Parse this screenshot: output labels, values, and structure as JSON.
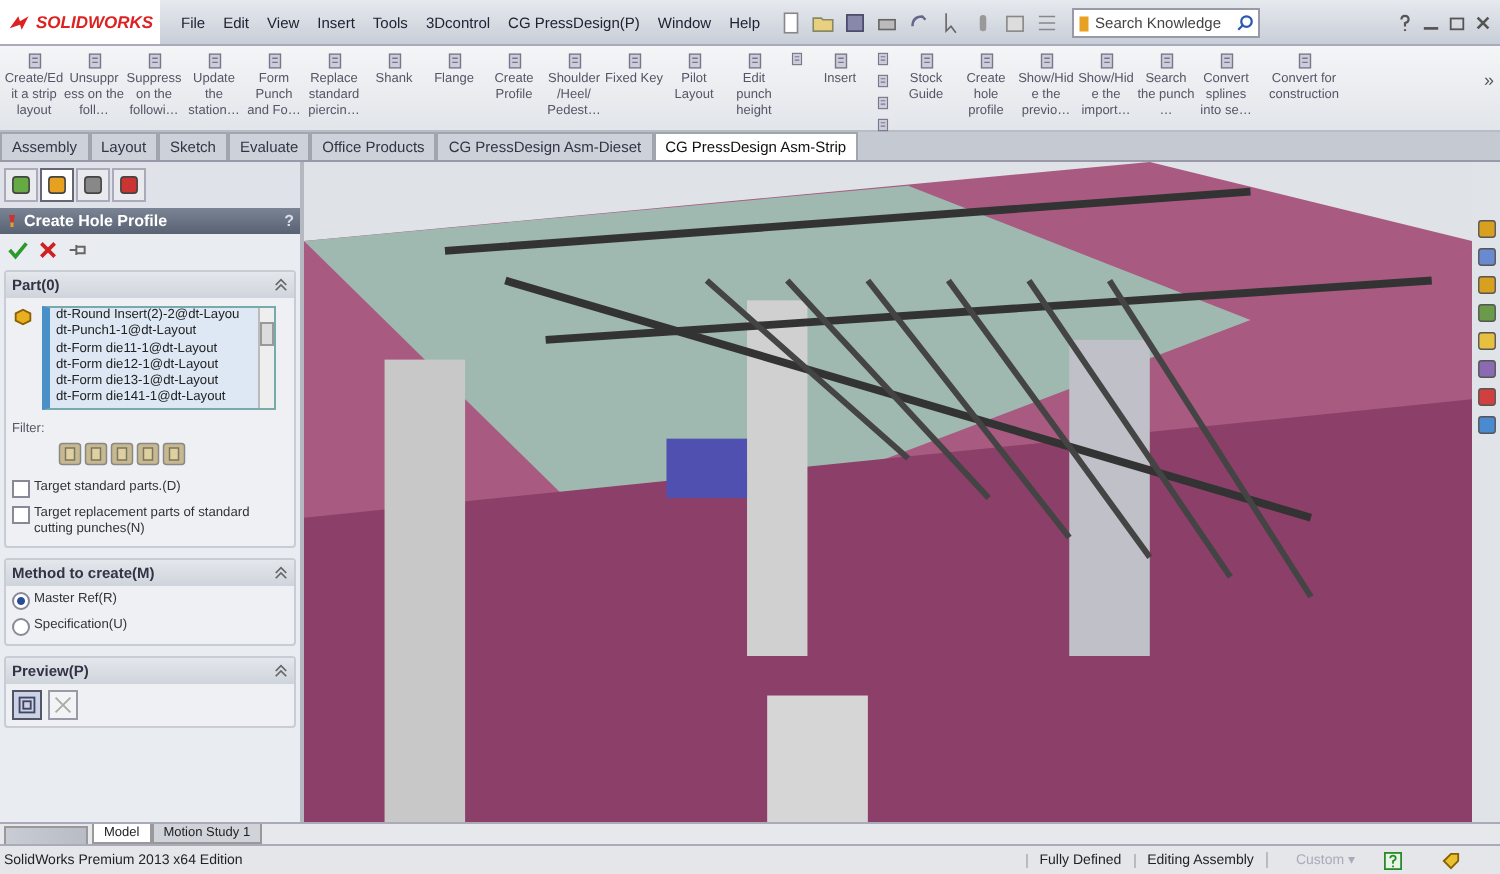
{
  "app": {
    "logo": "SOLIDWORKS"
  },
  "menu": [
    "File",
    "Edit",
    "View",
    "Insert",
    "Tools",
    "3Dcontrol",
    "CG PressDesign(P)",
    "Window",
    "Help"
  ],
  "search": {
    "placeholder": "Search Knowledge"
  },
  "ribbon": [
    {
      "label": "Create/Edit a strip layout"
    },
    {
      "label": "Unsuppr ess on the foll…"
    },
    {
      "label": "Suppress on the followi…"
    },
    {
      "label": "Update the station…"
    },
    {
      "label": "Form Punch and Fo…"
    },
    {
      "label": "Replace standard piercin…"
    },
    {
      "label": "Shank"
    },
    {
      "label": "Flange"
    },
    {
      "label": "Create Profile"
    },
    {
      "label": "Shoulder /Heel/ Pedest…"
    },
    {
      "label": "Fixed Key"
    },
    {
      "label": "Pilot Layout"
    },
    {
      "label": "Edit punch height"
    },
    {
      "label": "Insert"
    },
    {
      "label": "Stock Guide"
    },
    {
      "label": "Create hole profile"
    },
    {
      "label": "Show/Hid e the previo…"
    },
    {
      "label": "Show/Hid e the import…"
    },
    {
      "label": "Search the punch …"
    },
    {
      "label": "Convert splines into se…"
    },
    {
      "label": "Convert for construction"
    }
  ],
  "ribbon_more": "»",
  "tabs": [
    {
      "label": "Assembly",
      "selected": false
    },
    {
      "label": "Layout",
      "selected": false
    },
    {
      "label": "Sketch",
      "selected": false
    },
    {
      "label": "Evaluate",
      "selected": false
    },
    {
      "label": "Office Products",
      "selected": false
    },
    {
      "label": "CG PressDesign Asm-Dieset",
      "selected": false
    },
    {
      "label": "CG PressDesign Asm-Strip",
      "selected": true
    }
  ],
  "panel": {
    "title": "Create Hole Profile",
    "help": "?",
    "panel_tabs": [
      {
        "selected": false
      },
      {
        "selected": true
      },
      {
        "selected": false
      },
      {
        "selected": false
      }
    ],
    "part_section": {
      "title": "Part(0)",
      "items": [
        "dt-Round Insert(2)-2@dt-Layou",
        "dt-Punch1-1@dt-Layout",
        "dt-Form die11-1@dt-Layout",
        "dt-Form die12-1@dt-Layout",
        "dt-Form die13-1@dt-Layout",
        "dt-Form die141-1@dt-Layout"
      ],
      "filter_label": "Filter:",
      "options": [
        {
          "label": "Target standard parts.(D)",
          "checked": false
        },
        {
          "label": "Target replacement parts of standard cutting punches(N)",
          "checked": false
        }
      ]
    },
    "method_section": {
      "title": "Method to create(M)",
      "options": [
        {
          "label": "Master Ref(R)",
          "selected": true
        },
        {
          "label": "Specification(U)",
          "selected": false
        }
      ]
    },
    "preview_section": {
      "title": "Preview(P)"
    }
  },
  "bottom_tabs": [
    {
      "label": "Model",
      "selected": true
    },
    {
      "label": "Motion Study 1",
      "selected": false
    }
  ],
  "status_bar": {
    "edition": "SolidWorks Premium 2013 x64 Edition",
    "state": "Fully Defined",
    "mode": "Editing Assembly",
    "units": "Custom ▾"
  }
}
